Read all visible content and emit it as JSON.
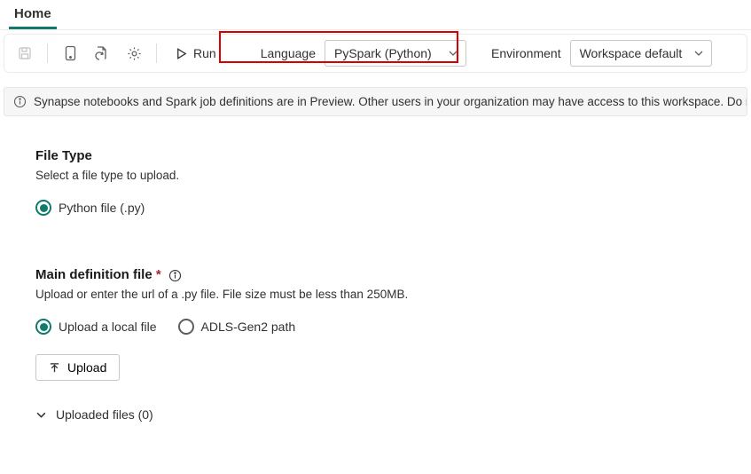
{
  "tabs": [
    {
      "label": "Home",
      "active": true
    }
  ],
  "toolbar": {
    "run_label": "Run",
    "language_label": "Language",
    "language_value": "PySpark (Python)",
    "environment_label": "Environment",
    "environment_value": "Workspace default"
  },
  "banner": {
    "text": "Synapse notebooks and Spark job definitions are in Preview. Other users in your organization may have access to this workspace. Do not use these items"
  },
  "file_type": {
    "title": "File Type",
    "subtitle": "Select a file type to upload.",
    "options": [
      {
        "label": "Python file (.py)",
        "selected": true
      }
    ]
  },
  "main_def": {
    "title": "Main definition file",
    "subtitle": "Upload or enter the url of a .py file. File size must be less than 250MB.",
    "options": [
      {
        "label": "Upload a local file",
        "selected": true
      },
      {
        "label": "ADLS-Gen2 path",
        "selected": false
      }
    ],
    "upload_button": "Upload",
    "uploaded_label": "Uploaded files (0)"
  }
}
